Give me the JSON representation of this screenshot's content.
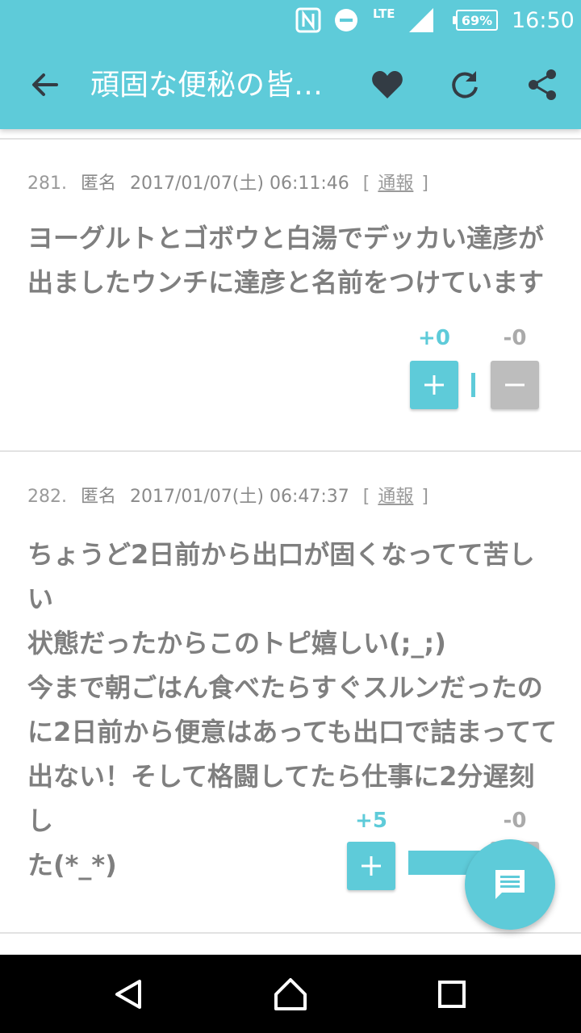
{
  "status_bar": {
    "lte": "LTE",
    "battery": "69%",
    "time": "16:50"
  },
  "app_bar": {
    "title": "頑固な便秘の皆…",
    "icons": [
      "back-arrow-icon",
      "heart-icon",
      "refresh-icon",
      "share-icon"
    ]
  },
  "posts": [
    {
      "number": "281.",
      "author": "匿名",
      "datetime": "2017/01/07(土) 06:11:46",
      "report_open": "[",
      "report": "通報",
      "report_close": "]",
      "body": "ヨーグルトとゴボウと白湯でデッカい達彦が\n出ましたウンチに達彦と名前をつけています",
      "plus_count": "+0",
      "minus_count": "-0",
      "plus_share": 0
    },
    {
      "number": "282.",
      "author": "匿名",
      "datetime": "2017/01/07(土) 06:47:37",
      "report_open": "[",
      "report": "通報",
      "report_close": "]",
      "body": "ちょうど2日前から出口が固くなってて苦しい\n状態だったからこのトピ嬉しい(;_;)\n今まで朝ごはん食べたらすぐスルンだったの\nに2日前から便意はあっても出口で詰まってて\n出ない！そして格闘してたら仕事に2分遅刻し\nた(*_*)",
      "plus_count": "+5",
      "minus_count": "-0",
      "plus_share": 1
    }
  ],
  "fab": {
    "icon": "comment-icon"
  },
  "colors": {
    "accent": "#5ecbd9",
    "minus": "#bdbdbd",
    "text": "#7f7f7f"
  }
}
